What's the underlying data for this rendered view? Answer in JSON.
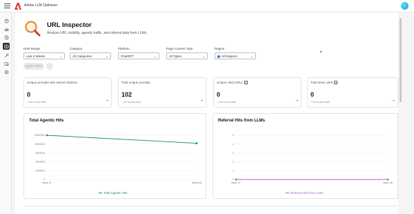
{
  "app": {
    "title": "Adobe LLM Optimizer"
  },
  "colors": {
    "accent_teal": "#178a7a",
    "accent_purple": "#a65fd6",
    "brand_red": "#d7372b"
  },
  "sidebar": {
    "items": [
      {
        "icon": "home-icon"
      },
      {
        "icon": "bar-chart-icon"
      },
      {
        "icon": "target-icon"
      },
      {
        "icon": "url-inspector-icon",
        "active": true
      },
      {
        "icon": "tools-icon"
      },
      {
        "icon": "refresh-icon"
      },
      {
        "icon": "settings-icon"
      }
    ]
  },
  "page": {
    "title": "URL Inspector",
    "subtitle": "Analyze URL visibility, agentic traffic, and referral data from LLMs"
  },
  "filters": {
    "date_range": {
      "label": "Date Range",
      "value": "Last 4 Weeks"
    },
    "category": {
      "label": "Category",
      "value": "All Categories"
    },
    "platform": {
      "label": "Platform",
      "value": "ChatGPT"
    },
    "page_content_type": {
      "label": "Page Content Type",
      "value": "All Types"
    },
    "region": {
      "label": "Region",
      "value": "All Regions"
    },
    "apply_label": "Apply Filters"
  },
  "cards": [
    {
      "label": "Unique prompts with owned citations",
      "value": "0",
      "change": "+ 0% vs last week"
    },
    {
      "label": "Total unique prompts",
      "value": "102",
      "change": "+ 0% vs last week"
    },
    {
      "label": "Unique cited URLs",
      "value": "0",
      "change": "+ 0% vs last week"
    },
    {
      "label": "Total times cited",
      "value": "0",
      "change": "+ 0% vs last week"
    }
  ],
  "charts": {
    "agentic": {
      "title": "Total Agentic Hits",
      "legend": "Total Agentic Hits"
    },
    "referral": {
      "title": "Referral Hits from LLMs",
      "legend": "Referral Hits from LLMs"
    }
  },
  "chart_data": [
    {
      "type": "line",
      "x": [
        "Week 37",
        "Week 38"
      ],
      "series": [
        {
          "name": "Total Agentic Hits",
          "values": [
            10000000,
            8200000
          ]
        }
      ],
      "yticks": [
        "10000000",
        "8000000",
        "6000000",
        "4000000",
        "2000000",
        "0"
      ],
      "ylim": [
        0,
        10000000
      ],
      "grid": true,
      "legend": "bottom"
    },
    {
      "type": "line",
      "x": [
        "Week 37",
        "Week 38"
      ],
      "series": [
        {
          "name": "Referral Hits from LLMs",
          "values": [
            0,
            0
          ]
        }
      ],
      "yticks": [
        "5",
        "4",
        "3",
        "2",
        "1",
        "0"
      ],
      "ylim": [
        0,
        5
      ],
      "grid": true,
      "legend": "bottom"
    }
  ]
}
